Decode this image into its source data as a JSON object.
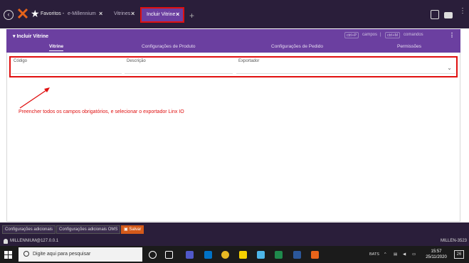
{
  "topbar": {
    "favorites_label": "Favoritos -",
    "tabs": [
      {
        "label": "e-Millennium"
      },
      {
        "label": "Vitrines"
      },
      {
        "label": "Incluir Vitrine"
      }
    ]
  },
  "panel": {
    "title": "Incluir Vitrine",
    "shortcut_campos_key": "ctrl+P",
    "shortcut_campos_label": "campos",
    "separator": "|",
    "shortcut_comandos_key": "ctrl+M",
    "shortcut_comandos_label": "comandos",
    "subtabs": [
      {
        "label": "Vitrine"
      },
      {
        "label": "Configurações de Produto"
      },
      {
        "label": "Configurações de Pedido"
      },
      {
        "label": "Permissões"
      }
    ]
  },
  "form": {
    "fields": [
      {
        "label": "Código",
        "value": ""
      },
      {
        "label": "Descrição",
        "value": ""
      },
      {
        "label": "Exportador",
        "value": ""
      }
    ]
  },
  "annotation": {
    "note": "Preencher todos os campos obrigatórios, e selecionar o exportador Linx IO"
  },
  "actions": {
    "additional_settings": "Configurações adicionais",
    "additional_settings_oms": "Configurações adicionais OMS",
    "save": "Salvar"
  },
  "status": {
    "user": "MILLENNIUM@127.0.0.1",
    "version": "MILLEN-3523"
  },
  "taskbar": {
    "search_placeholder": "Digite aqui para pesquisar",
    "tray_label": "BATS",
    "time": "15:57",
    "date": "25/11/2020",
    "notifications": "26"
  },
  "colors": {
    "header_purple": "#6b3fa0",
    "dark_bar": "#2a1e3a",
    "highlight_red": "#e01010",
    "save_orange": "#d45a1a"
  }
}
